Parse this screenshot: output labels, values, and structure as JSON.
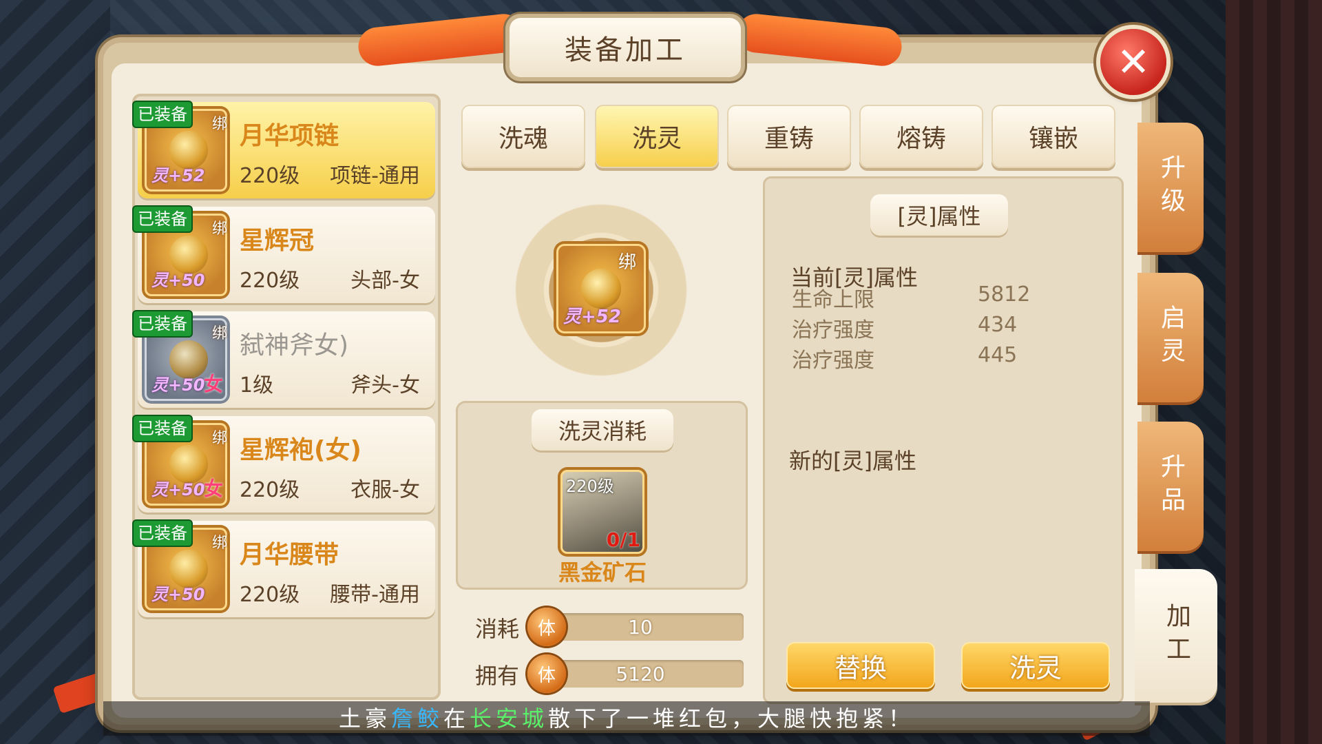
{
  "window": {
    "title": "装备加工",
    "close_icon": "close-icon"
  },
  "equipment_list": [
    {
      "name": "月华项链",
      "level": "220级",
      "slot": "项链-通用",
      "equipped_badge": "已装备",
      "bind": "绑",
      "ling": "灵+52",
      "gender": "",
      "selected": true,
      "disabled": false
    },
    {
      "name": "星辉冠",
      "level": "220级",
      "slot": "头部-女",
      "equipped_badge": "已装备",
      "bind": "绑",
      "ling": "灵+50",
      "gender": "",
      "selected": false,
      "disabled": false
    },
    {
      "name": "弑神斧女)",
      "level": "1级",
      "slot": "斧头-女",
      "equipped_badge": "已装备",
      "bind": "绑",
      "ling": "灵+50",
      "gender": "女",
      "selected": false,
      "disabled": true
    },
    {
      "name": "星辉袍(女)",
      "level": "220级",
      "slot": "衣服-女",
      "equipped_badge": "已装备",
      "bind": "绑",
      "ling": "灵+50",
      "gender": "女",
      "selected": false,
      "disabled": false
    },
    {
      "name": "月华腰带",
      "level": "220级",
      "slot": "腰带-通用",
      "equipped_badge": "已装备",
      "bind": "绑",
      "ling": "灵+50",
      "gender": "",
      "selected": false,
      "disabled": false
    }
  ],
  "tabs": [
    {
      "label": "洗魂",
      "active": false
    },
    {
      "label": "洗灵",
      "active": true
    },
    {
      "label": "重铸",
      "active": false
    },
    {
      "label": "熔铸",
      "active": false
    },
    {
      "label": "镶嵌",
      "active": false
    }
  ],
  "selected_item": {
    "bind": "绑",
    "ling": "灵+52"
  },
  "cost": {
    "title": "洗灵消耗",
    "material": {
      "name": "黑金矿石",
      "level": "220级",
      "count": "0/1"
    },
    "consume": {
      "label": "消耗",
      "icon_text": "体",
      "value": "10"
    },
    "own": {
      "label": "拥有",
      "icon_text": "体",
      "value": "5120"
    }
  },
  "attributes": {
    "title": "[灵]属性",
    "current_label": "当前[灵]属性",
    "current": [
      {
        "name": "生命上限",
        "value": "5812"
      },
      {
        "name": "治疗强度",
        "value": "434"
      },
      {
        "name": "治疗强度",
        "value": "445"
      }
    ],
    "new_label": "新的[灵]属性"
  },
  "buttons": {
    "replace": "替换",
    "wash": "洗灵"
  },
  "side_tabs": [
    {
      "label": "升级",
      "active": false
    },
    {
      "label": "启灵",
      "active": false
    },
    {
      "label": "升品",
      "active": false
    },
    {
      "label": "加工",
      "active": true
    }
  ],
  "marquee": {
    "prefix": "土豪",
    "player": "詹鲛",
    "mid": "在",
    "city": "长安城",
    "suffix": "散下了一堆红包，大腿快抱紧！"
  },
  "colors": {
    "accent_gold": "#f6cf4a",
    "equipped_green": "#1d9a33",
    "close_red": "#c8261d",
    "player_blue": "#37b8ff",
    "city_green": "#5bf06a"
  }
}
